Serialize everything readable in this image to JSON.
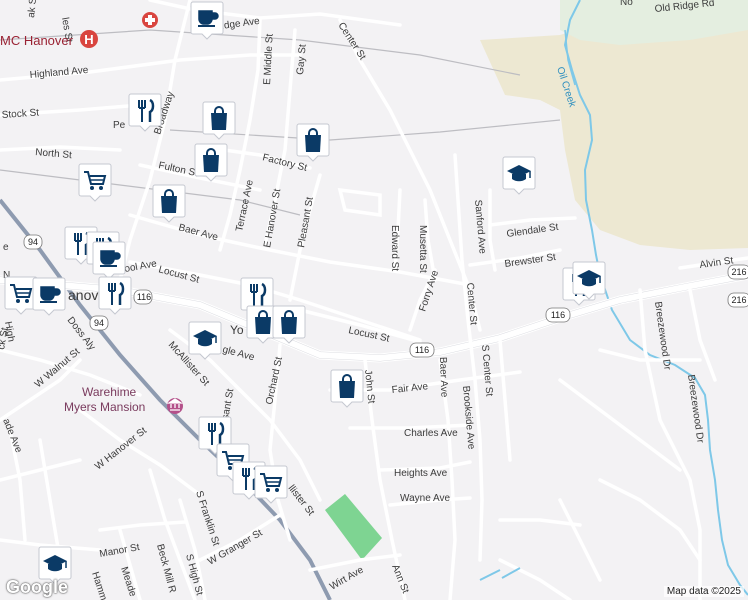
{
  "map": {
    "streets": [
      {
        "id": "ridge-ave",
        "label": "Ridge Ave"
      },
      {
        "id": "old-ridge-rd",
        "label": "Old Ridge Rd"
      },
      {
        "id": "highland-ave",
        "label": "Highland Ave"
      },
      {
        "id": "stock-st",
        "label": "Stock St"
      },
      {
        "id": "north-st",
        "label": "North St"
      },
      {
        "id": "fulton-st",
        "label": "Fulton St"
      },
      {
        "id": "factory-st",
        "label": "Factory St"
      },
      {
        "id": "broadway",
        "label": "Broadway"
      },
      {
        "id": "e-middle-st",
        "label": "E Middle St"
      },
      {
        "id": "gay-st",
        "label": "Gay St"
      },
      {
        "id": "center-st-n",
        "label": "Center St"
      },
      {
        "id": "terrace-ave",
        "label": "Terrace Ave"
      },
      {
        "id": "e-hanover-st",
        "label": "E Hanover St"
      },
      {
        "id": "pleasant-st",
        "label": "Pleasant St"
      },
      {
        "id": "baer-ave-w",
        "label": "Baer Ave"
      },
      {
        "id": "locust-st-w",
        "label": "Locust St"
      },
      {
        "id": "school-ave",
        "label": "School Ave"
      },
      {
        "id": "edward-st",
        "label": "Edward St"
      },
      {
        "id": "musetta-st",
        "label": "Musetta St"
      },
      {
        "id": "sanford-ave",
        "label": "Sanford Ave"
      },
      {
        "id": "glendale-st",
        "label": "Glendale St"
      },
      {
        "id": "brewster-st",
        "label": "Brewster St"
      },
      {
        "id": "forry-ave",
        "label": "Forry Ave"
      },
      {
        "id": "center-st-s",
        "label": "Center St"
      },
      {
        "id": "alvin-st",
        "label": "Alvin St"
      },
      {
        "id": "locust-st-e",
        "label": "Locust St"
      },
      {
        "id": "baer-ave-e",
        "label": "Baer Ave"
      },
      {
        "id": "s-center-st",
        "label": "S Center St"
      },
      {
        "id": "brookside-ave",
        "label": "Brookside Ave"
      },
      {
        "id": "breezewood-dr-1",
        "label": "Breezewood Dr"
      },
      {
        "id": "breezewood-dr-2",
        "label": "Breezewood Dr"
      },
      {
        "id": "eagle-ave",
        "label": "gle Ave"
      },
      {
        "id": "mcallister-st",
        "label": "McAllister St"
      },
      {
        "id": "orchard-st",
        "label": "Orchard St"
      },
      {
        "id": "john-st",
        "label": "John St"
      },
      {
        "id": "fair-ave",
        "label": "Fair Ave"
      },
      {
        "id": "charles-ave",
        "label": "Charles Ave"
      },
      {
        "id": "heights-ave",
        "label": "Heights Ave"
      },
      {
        "id": "wayne-ave",
        "label": "Wayne Ave"
      },
      {
        "id": "w-walnut-st",
        "label": "W Walnut St"
      },
      {
        "id": "doss-aly",
        "label": "Doss Aly"
      },
      {
        "id": "w-hanover-st",
        "label": "W Hanover St"
      },
      {
        "id": "s-franklin-st",
        "label": "S Franklin St"
      },
      {
        "id": "w-granger-st",
        "label": "W Granger St"
      },
      {
        "id": "manor-st",
        "label": "Manor St"
      },
      {
        "id": "meade",
        "label": "Meade"
      },
      {
        "id": "beck-mill-r",
        "label": "Beck Mill R"
      },
      {
        "id": "s-high-st",
        "label": "S High St"
      },
      {
        "id": "wirt-ave",
        "label": "Wirt Ave"
      },
      {
        "id": "ann-st",
        "label": "Ann St"
      },
      {
        "id": "allister-st",
        "label": "llister St"
      },
      {
        "id": "york-st",
        "label": "Yo"
      },
      {
        "id": "sant-st",
        "label": "sant St"
      },
      {
        "id": "ade-ave",
        "label": "ade Ave"
      },
      {
        "id": "high-frag",
        "label": "High"
      },
      {
        "id": "ck-st",
        "label": "ck St"
      },
      {
        "id": "pe-frag",
        "label": "Pe"
      },
      {
        "id": "hamm-frag",
        "label": "Hamm"
      },
      {
        "id": "ak-st",
        "label": "ak St"
      },
      {
        "id": "les-st",
        "label": "les St"
      },
      {
        "id": "e-frag",
        "label": "e"
      },
      {
        "id": "n-frag",
        "label": "N"
      },
      {
        "id": "nor-frag",
        "label": "No"
      }
    ],
    "route_shields": [
      {
        "id": "r116-a",
        "label": "116"
      },
      {
        "id": "r116-b",
        "label": "116"
      },
      {
        "id": "r116-c",
        "label": "116"
      },
      {
        "id": "r216-a",
        "label": "216"
      },
      {
        "id": "r216-b",
        "label": "216"
      },
      {
        "id": "r94-a",
        "label": "94"
      },
      {
        "id": "r94-b",
        "label": "94"
      }
    ],
    "places": {
      "hospital": "MC Hanover",
      "town": "anov",
      "mansion_1": "Warehime",
      "mansion_2": "Myers Mansion",
      "creek": "Oil Creek"
    },
    "pins": [
      {
        "id": "pin-cafe-top",
        "kind": "cafe"
      },
      {
        "id": "pin-restaurant-1",
        "kind": "restaurant"
      },
      {
        "id": "pin-shopping-1",
        "kind": "shopping"
      },
      {
        "id": "pin-shopping-2",
        "kind": "shopping"
      },
      {
        "id": "pin-shopping-3",
        "kind": "shopping"
      },
      {
        "id": "pin-grocery-1",
        "kind": "grocery"
      },
      {
        "id": "pin-shopping-4",
        "kind": "shopping"
      },
      {
        "id": "pin-school-1",
        "kind": "school"
      },
      {
        "id": "pin-restaurant-2",
        "kind": "restaurant"
      },
      {
        "id": "pin-restaurant-3",
        "kind": "restaurant"
      },
      {
        "id": "pin-cafe-2",
        "kind": "cafe"
      },
      {
        "id": "pin-grocery-2",
        "kind": "grocery"
      },
      {
        "id": "pin-cafe-3",
        "kind": "cafe"
      },
      {
        "id": "pin-restaurant-4",
        "kind": "restaurant"
      },
      {
        "id": "pin-restaurant-5",
        "kind": "restaurant"
      },
      {
        "id": "pin-shopping-5",
        "kind": "shopping"
      },
      {
        "id": "pin-shopping-6",
        "kind": "shopping"
      },
      {
        "id": "pin-school-2",
        "kind": "school"
      },
      {
        "id": "pin-shopping-7",
        "kind": "shopping"
      },
      {
        "id": "pin-restaurant-6",
        "kind": "restaurant"
      },
      {
        "id": "pin-grocery-3",
        "kind": "grocery"
      },
      {
        "id": "pin-restaurant-7",
        "kind": "restaurant"
      },
      {
        "id": "pin-grocery-4",
        "kind": "grocery"
      },
      {
        "id": "pin-school-3",
        "kind": "school"
      },
      {
        "id": "pin-restaurant-8",
        "kind": "restaurant"
      },
      {
        "id": "pin-school-4",
        "kind": "school"
      }
    ],
    "colors": {
      "pin_fill": "#0b3a66",
      "pin_bg": "#ffffff",
      "water": "#7ec8e8",
      "park": "#7ed492",
      "industrial": "#ede8d4",
      "background": "#f3f2f4"
    }
  },
  "footer": {
    "logo": "Google",
    "attribution": "Map data ©2025"
  }
}
